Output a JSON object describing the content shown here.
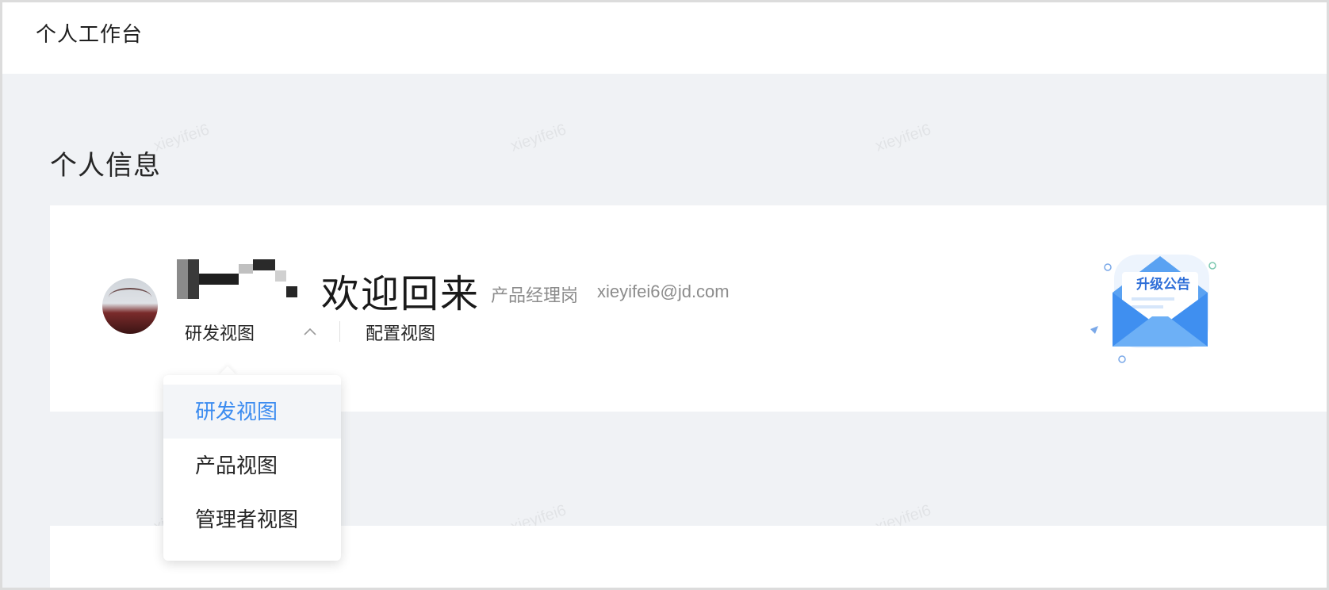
{
  "topbar": {
    "title": "个人工作台"
  },
  "section": {
    "title": "个人信息"
  },
  "watermark": "xieyifei6",
  "profile": {
    "welcome": "欢迎回来",
    "role": "产品经理岗",
    "email": "xieyifei6@jd.com",
    "current_view": "研发视图",
    "config_view": "配置视图"
  },
  "announcement": {
    "label": "升级公告"
  },
  "dropdown": {
    "items": [
      {
        "label": "研发视图",
        "active": true
      },
      {
        "label": "产品视图",
        "active": false
      },
      {
        "label": "管理者视图",
        "active": false
      }
    ]
  },
  "colors": {
    "accent": "#3c8cf0",
    "background": "#f0f2f5"
  }
}
